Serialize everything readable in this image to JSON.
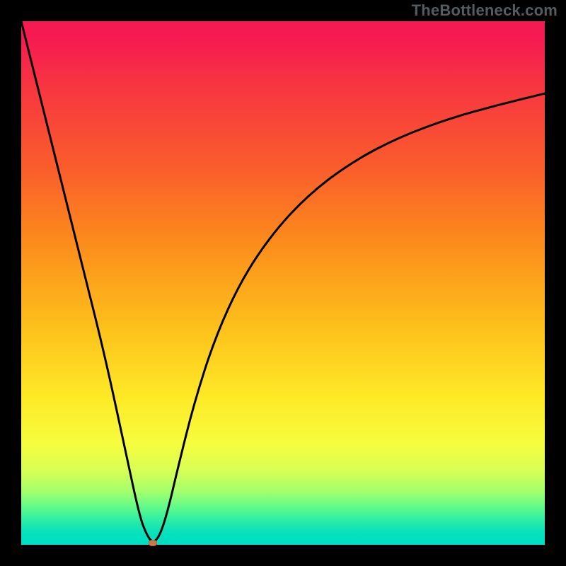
{
  "attribution": "TheBottleneck.com",
  "chart_data": {
    "type": "line",
    "title": "",
    "xlabel": "",
    "ylabel": "",
    "xlim": [
      0,
      1
    ],
    "ylim": [
      0,
      1
    ],
    "grid": false,
    "legend": false,
    "notes": "V-shaped bottleneck curve over red→yellow→green vertical gradient. Axes unlabeled (black border). Minimum marked with small oval dot.",
    "series": [
      {
        "name": "curve",
        "x": [
          0.0,
          0.04,
          0.08,
          0.12,
          0.16,
          0.2,
          0.226,
          0.24,
          0.252,
          0.265,
          0.28,
          0.3,
          0.33,
          0.37,
          0.42,
          0.48,
          0.55,
          0.63,
          0.72,
          0.82,
          0.91,
          1.0
        ],
        "y": [
          1.0,
          0.84,
          0.68,
          0.52,
          0.36,
          0.175,
          0.055,
          0.018,
          0.003,
          0.018,
          0.065,
          0.15,
          0.27,
          0.395,
          0.505,
          0.595,
          0.67,
          0.73,
          0.778,
          0.815,
          0.84,
          0.862
        ]
      }
    ],
    "marker": {
      "x": 0.252,
      "y": 0.003
    },
    "background_gradient_stops": [
      {
        "pos": 0.0,
        "hex": "#f61a52"
      },
      {
        "pos": 0.28,
        "hex": "#fa5d2c"
      },
      {
        "pos": 0.58,
        "hex": "#fdbf1b"
      },
      {
        "pos": 0.81,
        "hex": "#f5fd3f"
      },
      {
        "pos": 0.93,
        "hex": "#5cf98b"
      },
      {
        "pos": 1.0,
        "hex": "#00dfc1"
      }
    ]
  }
}
